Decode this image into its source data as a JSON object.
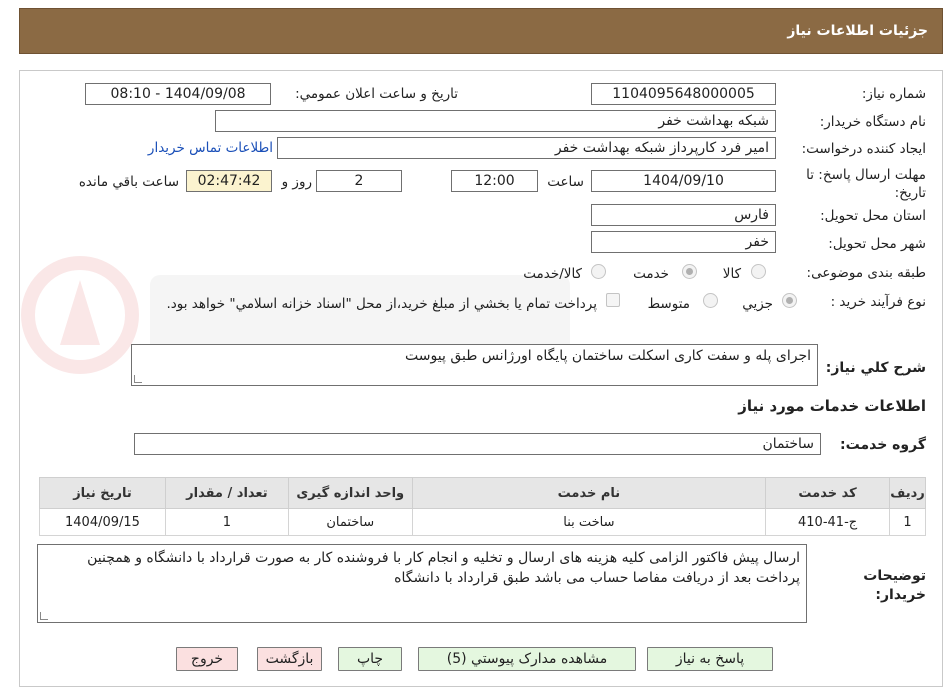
{
  "header": {
    "title": "جزئیات اطلاعات نیاز"
  },
  "form": {
    "need_number_label": "شماره نیاز:",
    "need_number": "1104095648000005",
    "announce_label": "تاریخ و ساعت اعلان عمومي:",
    "announce_value": "1404/09/08 - 08:10",
    "buyer_org_label": "نام دستگاه خريدار:",
    "buyer_org": "شبکه بهداشت خفر",
    "creator_label": "ايجاد کننده درخواست:",
    "creator": "امير فرد کارپرداز شبکه بهداشت خفر",
    "contact_link": "اطلاعات تماس خريدار",
    "deadline_label": "مهلت ارسال پاسخ: تا تاريخ:",
    "deadline_date": "1404/09/10",
    "time_label": "ساعت",
    "deadline_time": "12:00",
    "days_value": "2",
    "days_label": "روز و",
    "remaining_time": "02:47:42",
    "remaining_label": "ساعت باقي مانده",
    "province_label": "استان محل تحويل:",
    "province": "فارس",
    "city_label": "شهر محل تحويل:",
    "city": "خفر",
    "category_label": "طبقه بندی موضوعی:",
    "category_options": [
      "کالا",
      "خدمت",
      "کالا/خدمت"
    ],
    "process_label": "نوع فرآيند خريد :",
    "process_options": [
      "جزيي",
      "متوسط"
    ],
    "process_note": "پرداخت تمام يا بخشي از مبلغ خريد،از محل \"اسناد خزانه اسلامي\" خواهد بود.",
    "summary_label": "شرح کلي نياز:",
    "summary": "اجرای پله و سفت کاری اسکلت ساختمان پایگاه اورژانس طبق پیوست"
  },
  "services": {
    "section_title": "اطلاعات خدمات مورد نياز",
    "group_label": "گروه خدمت:",
    "group_value": "ساختمان",
    "columns": [
      "رديف",
      "کد خدمت",
      "نام خدمت",
      "واحد اندازه گيری",
      "تعداد / مقدار",
      "تاريخ نياز"
    ],
    "rows": [
      [
        "1",
        "ج-41-410",
        "ساخت بنا",
        "ساختمان",
        "1",
        "1404/09/15"
      ]
    ]
  },
  "notes": {
    "label": "توضيحات خريدار:",
    "text": "ارسال پیش فاکتور الزامی کلیه هزینه های ارسال و تخلیه و انجام کار با فروشنده کار به صورت قرارداد با دانشگاه و همچنین پرداخت بعد از دریافت مفاصا حساب می باشد طبق قرارداد با دانشگاه"
  },
  "buttons": {
    "reply": "پاسخ به نياز",
    "attachments": "مشاهده مدارک پيوستي (5)",
    "print": "چاپ",
    "back": "بازگشت",
    "exit": "خروج"
  }
}
